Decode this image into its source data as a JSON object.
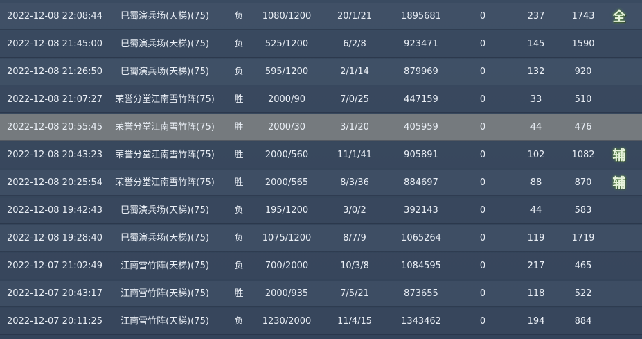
{
  "rows": [
    {
      "time": "2022-12-08 22:08:44",
      "map": "巴蜀演兵场(天梯)(75)",
      "result": "负",
      "score": "1080/1200",
      "kda": "20/1/21",
      "damage": "1895681",
      "zero": "0",
      "a": "237",
      "b": "1743",
      "badge": "全"
    },
    {
      "time": "2022-12-08 21:45:00",
      "map": "巴蜀演兵场(天梯)(75)",
      "result": "负",
      "score": "525/1200",
      "kda": "6/2/8",
      "damage": "923471",
      "zero": "0",
      "a": "145",
      "b": "1590",
      "badge": ""
    },
    {
      "time": "2022-12-08 21:26:50",
      "map": "巴蜀演兵场(天梯)(75)",
      "result": "负",
      "score": "595/1200",
      "kda": "2/1/14",
      "damage": "879969",
      "zero": "0",
      "a": "132",
      "b": "920",
      "badge": ""
    },
    {
      "time": "2022-12-08 21:07:27",
      "map": "荣誉分堂江南雪竹阵(75)",
      "result": "胜",
      "score": "2000/90",
      "kda": "7/0/25",
      "damage": "447159",
      "zero": "0",
      "a": "33",
      "b": "510",
      "badge": ""
    },
    {
      "time": "2022-12-08 20:55:45",
      "map": "荣誉分堂江南雪竹阵(75)",
      "result": "胜",
      "score": "2000/30",
      "kda": "3/1/20",
      "damage": "405959",
      "zero": "0",
      "a": "44",
      "b": "476",
      "badge": ""
    },
    {
      "time": "2022-12-08 20:43:23",
      "map": "荣誉分堂江南雪竹阵(75)",
      "result": "胜",
      "score": "2000/560",
      "kda": "11/1/41",
      "damage": "905891",
      "zero": "0",
      "a": "102",
      "b": "1082",
      "badge": "辅"
    },
    {
      "time": "2022-12-08 20:25:54",
      "map": "荣誉分堂江南雪竹阵(75)",
      "result": "胜",
      "score": "2000/565",
      "kda": "8/3/36",
      "damage": "884697",
      "zero": "0",
      "a": "88",
      "b": "870",
      "badge": "辅"
    },
    {
      "time": "2022-12-08 19:42:43",
      "map": "巴蜀演兵场(天梯)(75)",
      "result": "负",
      "score": "195/1200",
      "kda": "3/0/2",
      "damage": "392143",
      "zero": "0",
      "a": "44",
      "b": "583",
      "badge": ""
    },
    {
      "time": "2022-12-08 19:28:40",
      "map": "巴蜀演兵场(天梯)(75)",
      "result": "负",
      "score": "1075/1200",
      "kda": "8/7/9",
      "damage": "1065264",
      "zero": "0",
      "a": "119",
      "b": "1719",
      "badge": ""
    },
    {
      "time": "2022-12-07 21:02:49",
      "map": "江南雪竹阵(天梯)(75)",
      "result": "负",
      "score": "700/2000",
      "kda": "10/3/8",
      "damage": "1084595",
      "zero": "0",
      "a": "217",
      "b": "465",
      "badge": ""
    },
    {
      "time": "2022-12-07 20:43:17",
      "map": "江南雪竹阵(天梯)(75)",
      "result": "胜",
      "score": "2000/935",
      "kda": "7/5/21",
      "damage": "873655",
      "zero": "0",
      "a": "118",
      "b": "522",
      "badge": ""
    },
    {
      "time": "2022-12-07 20:11:25",
      "map": "江南雪竹阵(天梯)(75)",
      "result": "负",
      "score": "1230/2000",
      "kda": "11/4/15",
      "damage": "1343462",
      "zero": "0",
      "a": "194",
      "b": "884",
      "badge": ""
    }
  ],
  "selected_row_index": 4,
  "colors": {
    "background": "#36465b",
    "selected_row": "#808484",
    "text": "#e9eef5",
    "badge_glow": "#6f9f5a"
  }
}
